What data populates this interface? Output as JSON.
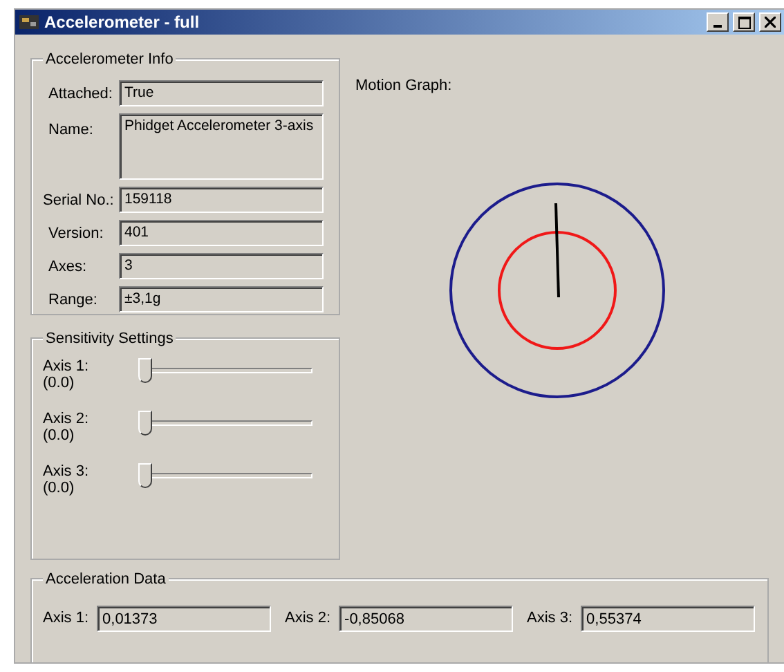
{
  "window": {
    "title": "Accelerometer - full"
  },
  "info": {
    "title": "Accelerometer Info",
    "fields": [
      {
        "label": "Attached:",
        "value": "True",
        "kind": "line"
      },
      {
        "label": "Name:",
        "value": "Phidget Accelerometer 3-axis",
        "kind": "multi"
      },
      {
        "label": "Serial No.:",
        "value": "159118",
        "kind": "line"
      },
      {
        "label": "Version:",
        "value": "401",
        "kind": "line"
      },
      {
        "label": "Axes:",
        "value": "3",
        "kind": "line"
      },
      {
        "label": "Range:",
        "value": "±3,1g",
        "kind": "line"
      }
    ]
  },
  "sensitivity": {
    "title": "Sensitivity Settings",
    "axes": [
      {
        "label": "Axis 1:",
        "reading": "(0.0)",
        "level": 0
      },
      {
        "label": "Axis 2:",
        "reading": "(0.0)",
        "level": 0
      },
      {
        "label": "Axis 3:",
        "reading": "(0.0)",
        "level": 0
      }
    ]
  },
  "motion_graph": {
    "label": "Motion Graph:"
  },
  "acceleration": {
    "title": "Acceleration Data",
    "axes": [
      {
        "label": "Axis 1:",
        "value": "0,01373"
      },
      {
        "label": "Axis 2:",
        "value": "-0,85068"
      },
      {
        "label": "Axis 3:",
        "value": "0,55374"
      }
    ]
  }
}
